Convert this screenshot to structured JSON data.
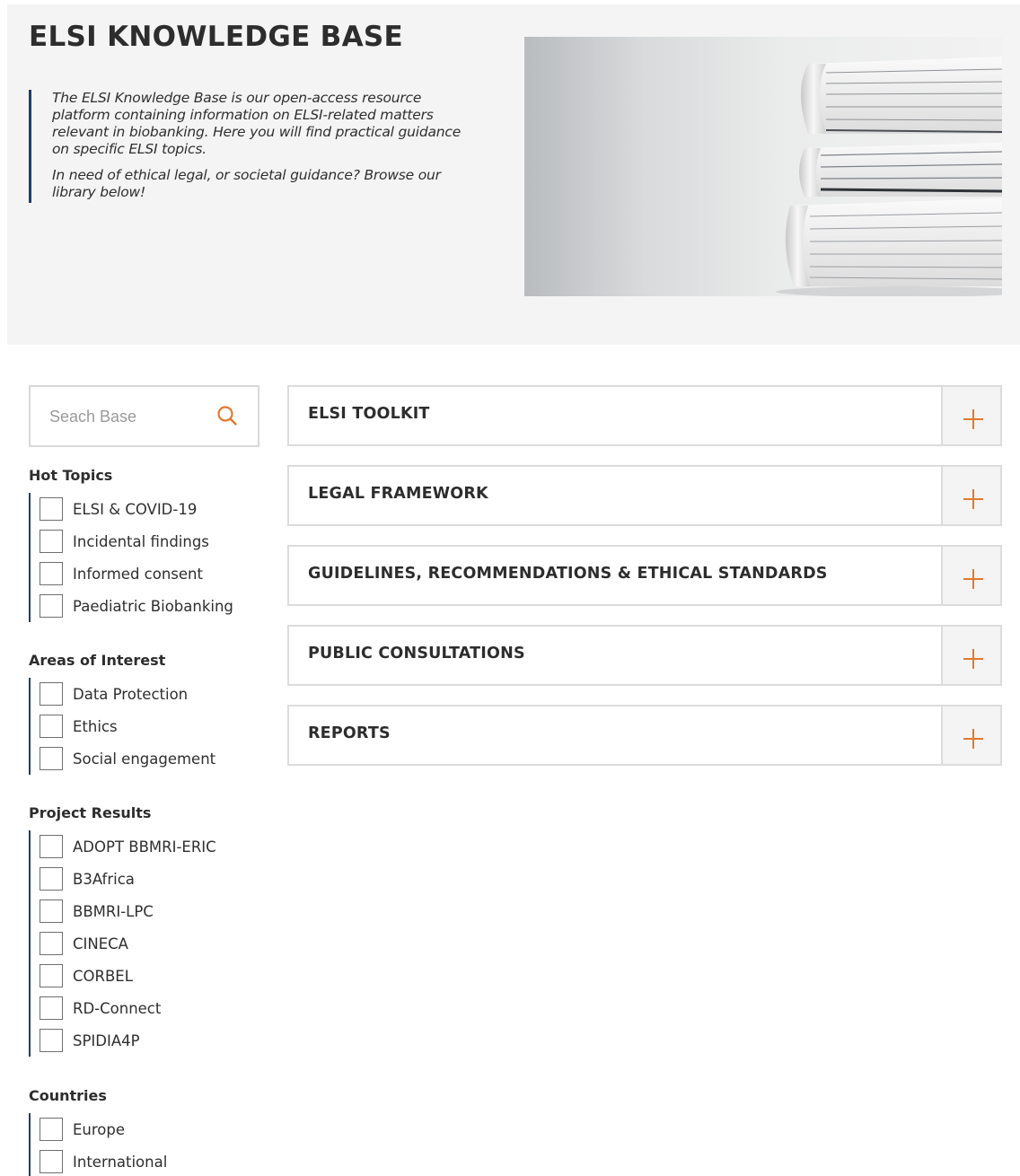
{
  "header": {
    "title": "ELSI KNOWLEDGE BASE",
    "intro_paragraph_1": "The ELSI Knowledge Base is our open-access resource platform containing information on ELSI-related matters relevant in biobanking. Here you will find practical guidance on specific ELSI topics.",
    "intro_paragraph_2": "In need of ethical legal, or societal guidance? Browse our library below!"
  },
  "search": {
    "placeholder": "Seach Base",
    "value": "",
    "icon": "search-icon"
  },
  "filters": [
    {
      "heading": "Hot Topics",
      "items": [
        "ELSI & COVID-19",
        "Incidental findings",
        "Informed consent",
        "Paediatric Biobanking"
      ]
    },
    {
      "heading": "Areas of Interest",
      "items": [
        "Data Protection",
        "Ethics",
        "Social engagement"
      ]
    },
    {
      "heading": "Project Results",
      "items": [
        "ADOPT BBMRI-ERIC",
        "B3Africa",
        "BBMRI-LPC",
        "CINECA",
        "CORBEL",
        "RD-Connect",
        "SPIDIA4P"
      ]
    },
    {
      "heading": "Countries",
      "items": [
        "Europe",
        "International"
      ]
    }
  ],
  "sections": [
    {
      "title": "ELSI TOOLKIT",
      "expanded": false
    },
    {
      "title": "LEGAL FRAMEWORK",
      "expanded": false
    },
    {
      "title": "GUIDELINES, RECOMMENDATIONS & ETHICAL STANDARDS",
      "expanded": false
    },
    {
      "title": "PUBLIC CONSULTATIONS",
      "expanded": false
    },
    {
      "title": "REPORTS",
      "expanded": false
    }
  ],
  "colors": {
    "accent": "#e07a2e",
    "rule": "#1e3f6b",
    "hero_background": "#f4f4f4"
  }
}
